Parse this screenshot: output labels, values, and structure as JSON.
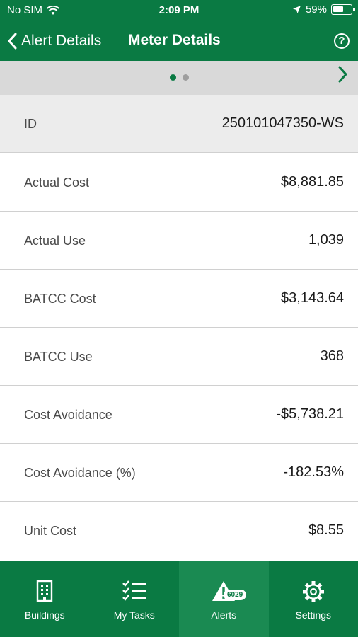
{
  "status_bar": {
    "carrier": "No SIM",
    "time": "2:09 PM",
    "battery_percent": "59%",
    "battery_level": 0.59
  },
  "nav": {
    "back_label": "Alert Details",
    "title": "Meter Details",
    "help_icon": "?"
  },
  "pager": {
    "pages": 2,
    "current": 0,
    "active_color": "#0a7a43",
    "inactive_color": "#9e9e9e"
  },
  "id_row": {
    "label": "ID",
    "value": "250101047350-WS"
  },
  "rows": [
    {
      "label": "Actual Cost",
      "value": "$8,881.85"
    },
    {
      "label": "Actual Use",
      "value": "1,039"
    },
    {
      "label": "BATCC Cost",
      "value": "$3,143.64"
    },
    {
      "label": "BATCC Use",
      "value": "368"
    },
    {
      "label": "Cost Avoidance",
      "value": "-$5,738.21"
    },
    {
      "label": "Cost Avoidance (%)",
      "value": "-182.53%"
    },
    {
      "label": "Unit Cost",
      "value": "$8.55"
    }
  ],
  "tabs": [
    {
      "label": "Buildings",
      "icon": "building-icon"
    },
    {
      "label": "My Tasks",
      "icon": "tasks-icon"
    },
    {
      "label": "Alerts",
      "icon": "alert-icon",
      "badge": "6029",
      "active": true
    },
    {
      "label": "Settings",
      "icon": "gear-icon"
    }
  ],
  "colors": {
    "brand_green": "#0a7a43",
    "active_tab": "#1a8a52",
    "pager_bg": "#d9d9d9",
    "id_row_bg": "#ececec"
  }
}
